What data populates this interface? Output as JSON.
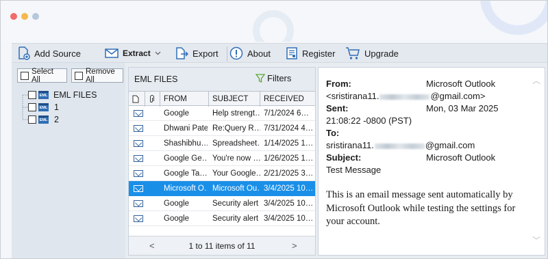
{
  "window": {
    "dots": [
      "#f26b6b",
      "#f5b84a",
      "#b5c8dc"
    ]
  },
  "toolbar": {
    "add_source": "Add Source",
    "extract": "Extract",
    "export": "Export",
    "about": "About",
    "register": "Register",
    "upgrade": "Upgrade",
    "icon_color": "#2f6db5"
  },
  "left_panel": {
    "select_all": "Select All",
    "remove_all": "Remove All",
    "tree": {
      "root": "EML FILES",
      "children": [
        "1",
        "2"
      ],
      "icon_text": "EML"
    }
  },
  "message_list": {
    "title": "EML FILES",
    "filters": "Filters",
    "columns": {
      "from": "FROM",
      "subject": "SUBJECT",
      "received": "RECEIVED"
    },
    "rows": [
      {
        "from": "Google",
        "subject": "Help strengt…",
        "received": "7/1/2024 6…",
        "selected": false
      },
      {
        "from": "Dhwani Patel",
        "subject": "Re:Query R…",
        "received": "7/31/2024 4…",
        "selected": false
      },
      {
        "from": "Shashibhu…",
        "subject": "Spreadsheet…",
        "received": "1/14/2025 1…",
        "selected": false
      },
      {
        "from": "Google Ge…",
        "subject": "You're now …",
        "received": "1/26/2025 1…",
        "selected": false
      },
      {
        "from": "Google Ta…",
        "subject": "Your Google…",
        "received": "2/21/2025 3…",
        "selected": false
      },
      {
        "from": "Microsoft O…",
        "subject": "Microsoft Ou…",
        "received": "3/4/2025 10…",
        "selected": true
      },
      {
        "from": "Google",
        "subject": "Security alert",
        "received": "3/4/2025 10…",
        "selected": false
      },
      {
        "from": "Google",
        "subject": "Security alert",
        "received": "3/4/2025 10…",
        "selected": false
      }
    ],
    "pager": {
      "prev": "<",
      "text": "1 to 11 items of 11",
      "next": ">"
    },
    "selection_color": "#1a8fe8"
  },
  "preview": {
    "from_label": "From:",
    "from_value": "Microsoft Outlook",
    "from_email_user": "<sristirana11.",
    "from_email_domain": "@gmail.com>",
    "sent_label": "Sent:",
    "sent_value": "Mon, 03 Mar 2025",
    "sent_time": "21:08:22 -0800 (PST)",
    "to_label": "To:",
    "to_email_user": "sristirana11.",
    "to_email_domain": "@gmail.com",
    "subject_label": "Subject:",
    "subject_value": "Microsoft Outlook",
    "subject_line2": "Test Message",
    "body": "This is an email message sent automatically by Microsoft Outlook while testing the settings for your account.",
    "scroll_up": "︿",
    "scroll_down": "﹀"
  }
}
